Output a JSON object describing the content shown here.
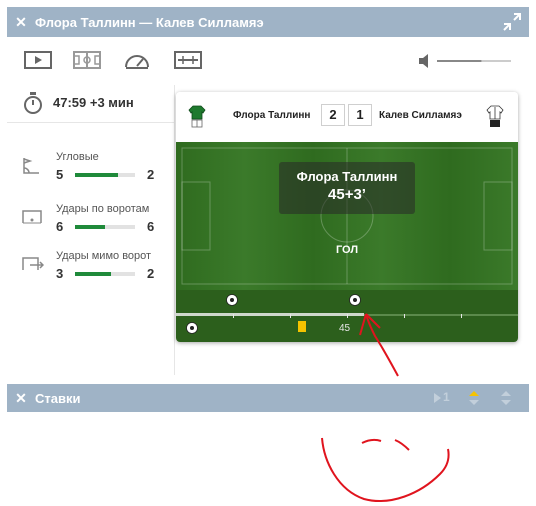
{
  "header": {
    "close_label": "✕",
    "title": "Флора Таллинн — Калев Силламяэ"
  },
  "toolbar": {
    "icons": [
      "play-icon",
      "field-icon",
      "speedometer-icon",
      "timeline-icon"
    ],
    "volume_level": 0.6
  },
  "timer": {
    "text": "47:59 +3 мин"
  },
  "stats": [
    {
      "label": "Угловые",
      "home": "5",
      "away": "2",
      "home_share": 0.71
    },
    {
      "label": "Удары по воротам",
      "home": "6",
      "away": "6",
      "home_share": 0.5
    },
    {
      "label": "Удары мимо ворот",
      "home": "3",
      "away": "2",
      "home_share": 0.6
    }
  ],
  "match": {
    "home_team": "Флора Таллинн",
    "away_team": "Калев Силламяэ",
    "home_score": "2",
    "away_score": "1",
    "event_team": "Флора Таллинн",
    "event_time": "45+3’",
    "event_type": "ГОЛ",
    "timeline_mark": "45",
    "played_fraction": 0.55
  },
  "bets": {
    "close_label": "✕",
    "title": "Ставки",
    "counter": "1"
  },
  "colors": {
    "header_bg": "#9fb3c6",
    "stat_bar": "#1f8a3a",
    "pitch": "#3b7a2a",
    "annotation": "#e0141e"
  }
}
